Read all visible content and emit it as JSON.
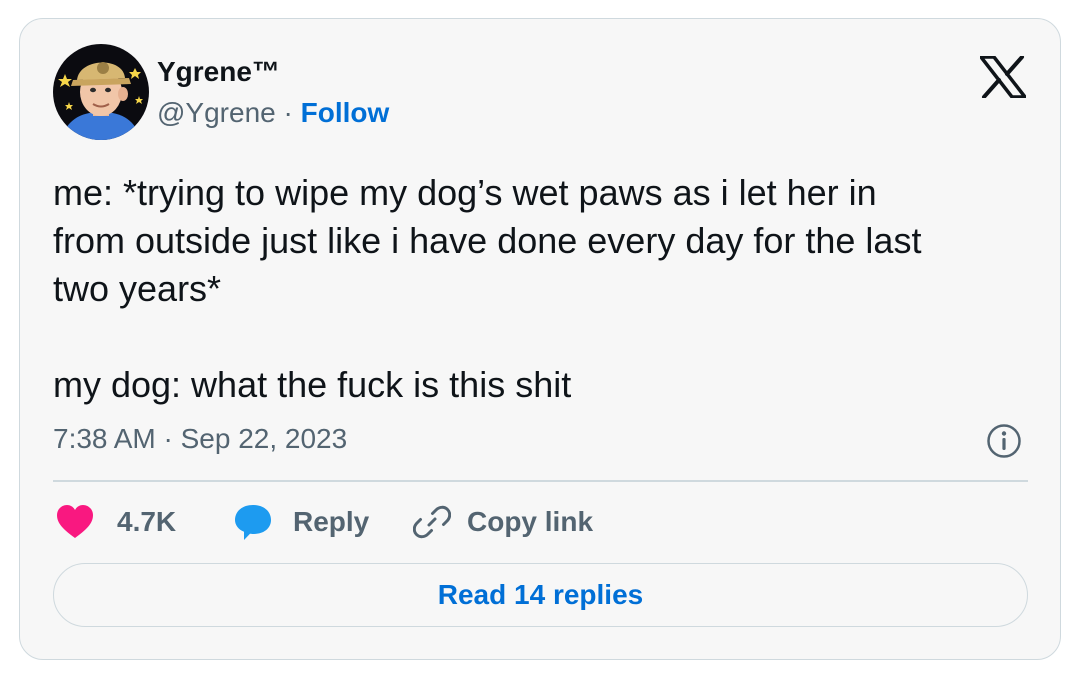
{
  "author": {
    "display_name": "Ygrene™",
    "handle": "@Ygrene",
    "separator": " · ",
    "follow_label": "Follow"
  },
  "tweet": {
    "text": "me: *trying to wipe my dog’s wet paws as i let her in\nfrom outside just like i have done every day for the last\ntwo years*\n\nmy dog: what the fuck is this shit",
    "timestamp": "7:38 AM · Sep 22, 2023"
  },
  "actions": {
    "like_count": "4.7K",
    "reply_label": "Reply",
    "copy_link_label": "Copy link"
  },
  "read_replies_label": "Read 14 replies",
  "icons": {
    "brand": "x-logo-icon",
    "info": "info-icon",
    "like": "heart-icon",
    "reply": "speech-bubble-icon",
    "copy": "link-icon"
  },
  "colors": {
    "card_background": "#f7f7f7",
    "border": "#cfd9de",
    "link_blue": "#006fd6",
    "like_pink": "#f91880",
    "reply_blue": "#1d9bf0",
    "secondary_text": "#536471",
    "primary_text": "#0f1419"
  }
}
